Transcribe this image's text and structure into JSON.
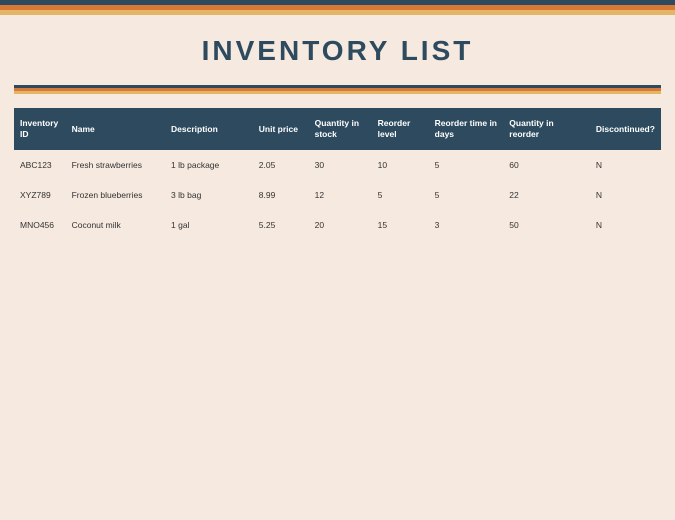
{
  "header": {
    "title": "INVENTORY LIST"
  },
  "table": {
    "columns": {
      "inventory_id": "Inventory ID",
      "name": "Name",
      "description": "Description",
      "unit_price": "Unit price",
      "qty_stock": "Quantity in stock",
      "reorder_level": "Reorder level",
      "reorder_time": "Reorder time in days",
      "qty_reorder": "Quantity in reorder",
      "discontinued": "Discontinued?"
    },
    "rows": [
      {
        "inventory_id": "ABC123",
        "name": "Fresh strawberries",
        "description": "1 lb package",
        "unit_price": "2.05",
        "qty_stock": "30",
        "reorder_level": "10",
        "reorder_time": "5",
        "qty_reorder": "60",
        "discontinued": "N"
      },
      {
        "inventory_id": "XYZ789",
        "name": "Frozen blueberries",
        "description": "3 lb bag",
        "unit_price": "8.99",
        "qty_stock": "12",
        "reorder_level": "5",
        "reorder_time": "5",
        "qty_reorder": "22",
        "discontinued": "N"
      },
      {
        "inventory_id": "MNO456",
        "name": "Coconut milk",
        "description": "1 gal",
        "unit_price": "5.25",
        "qty_stock": "20",
        "reorder_level": "15",
        "reorder_time": "3",
        "qty_reorder": "50",
        "discontinued": "N"
      }
    ]
  },
  "colors": {
    "navy": "#2d4a5e",
    "orange": "#d97938",
    "yellow": "#e5b567",
    "bg": "#f6e9df"
  }
}
